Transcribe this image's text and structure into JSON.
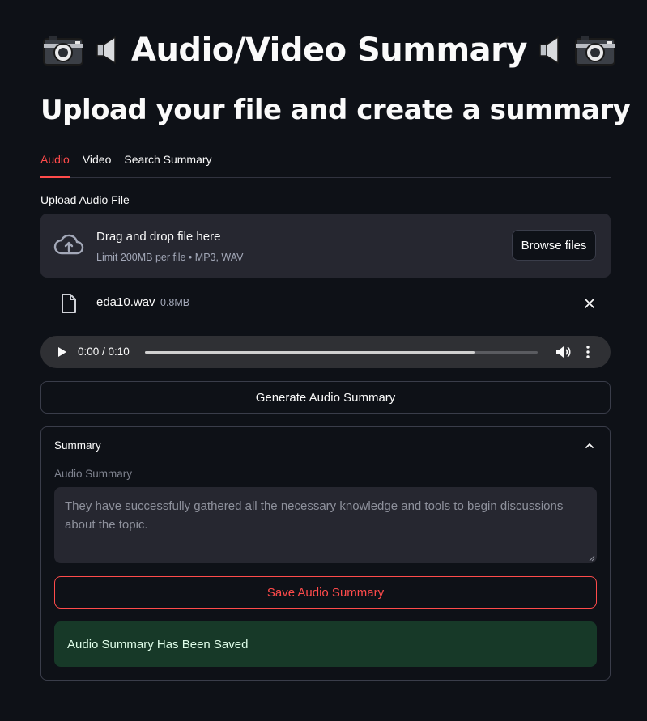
{
  "header": {
    "title": "Audio/Video Summary",
    "icons": [
      "camera-icon",
      "speaker-icon",
      "speaker-icon",
      "camera-icon"
    ]
  },
  "subtitle": "Upload your file and create a summary",
  "tabs": [
    {
      "label": "Audio",
      "active": true
    },
    {
      "label": "Video",
      "active": false
    },
    {
      "label": "Search Summary",
      "active": false
    }
  ],
  "uploader": {
    "label": "Upload Audio File",
    "drop_title": "Drag and drop file here",
    "limit_text": "Limit 200MB per file • MP3, WAV",
    "browse_label": "Browse files",
    "icon": "cloud-upload-icon"
  },
  "file": {
    "name": "eda10.wav",
    "size": "0.8MB"
  },
  "player": {
    "time": "0:00 / 0:10",
    "progress_fraction": 0.84
  },
  "generate_button": "Generate Audio Summary",
  "summary": {
    "header": "Summary",
    "textarea_label": "Audio Summary",
    "text": "They have successfully gathered all the necessary knowledge and tools to begin discussions about the topic.",
    "save_button": "Save Audio Summary",
    "success_message": "Audio Summary Has Been Saved"
  },
  "colors": {
    "background": "#0e1117",
    "accent": "#ff4b4b",
    "surface": "#262730",
    "success_bg": "#173928"
  }
}
